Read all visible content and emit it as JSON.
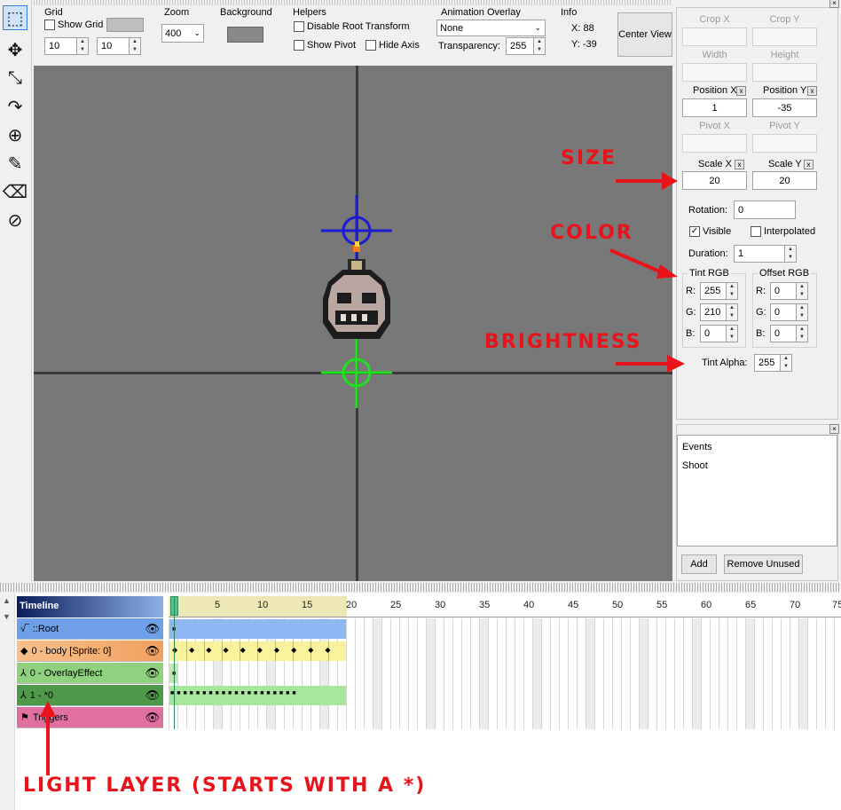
{
  "toolbar": {
    "grid": {
      "title": "Grid",
      "show_grid_label": "Show Grid",
      "show_grid_checked": false,
      "size_x": "10",
      "size_y": "10"
    },
    "zoom": {
      "title": "Zoom",
      "value": "400"
    },
    "background": {
      "title": "Background"
    },
    "helpers": {
      "title": "Helpers",
      "disable_root_label": "Disable Root Transform",
      "show_pivot_label": "Show Pivot",
      "hide_axis_label": "Hide Axis"
    },
    "overlay": {
      "title": "Animation Overlay",
      "value": "None",
      "transparency_label": "Transparency:",
      "transparency_value": "255"
    },
    "info": {
      "title": "Info",
      "x": "X: 88",
      "y": "Y: -39"
    },
    "center_view_label": "Center View"
  },
  "tools": [
    {
      "name": "select-tool",
      "glyph": "⬚"
    },
    {
      "name": "move-tool",
      "glyph": "✥"
    },
    {
      "name": "scale-tool",
      "glyph": "⤡"
    },
    {
      "name": "rotate-tool",
      "glyph": "↷"
    },
    {
      "name": "pivot-tool",
      "glyph": "⊕"
    },
    {
      "name": "pencil-tool",
      "glyph": "✎"
    },
    {
      "name": "eraser-tool",
      "glyph": "⌫"
    },
    {
      "name": "anchor-tool",
      "glyph": "⊘"
    }
  ],
  "properties": {
    "crop_x": "Crop X",
    "crop_y": "Crop Y",
    "width": "Width",
    "height": "Height",
    "position_x_label": "Position X",
    "position_y_label": "Position Y",
    "position_x": "1",
    "position_y": "-35",
    "pivot_x": "Pivot X",
    "pivot_y": "Pivot Y",
    "scale_x_label": "Scale X",
    "scale_y_label": "Scale Y",
    "scale_x": "20",
    "scale_y": "20",
    "rotation_label": "Rotation:",
    "rotation": "0",
    "visible_label": "Visible",
    "visible_checked": true,
    "interpolated_label": "Interpolated",
    "interpolated_checked": false,
    "duration_label": "Duration:",
    "duration": "1",
    "tint_title": "Tint RGB",
    "offset_title": "Offset RGB",
    "tint": {
      "r": "255",
      "g": "210",
      "b": "0"
    },
    "offset": {
      "r": "0",
      "g": "0",
      "b": "0"
    },
    "r": "R:",
    "g": "G:",
    "b": "B:",
    "tint_alpha_label": "Tint Alpha:",
    "tint_alpha": "255",
    "x_mark": "x"
  },
  "events": {
    "items": [
      "Events",
      "Shoot"
    ],
    "add_label": "Add",
    "remove_label": "Remove Unused"
  },
  "timeline": {
    "title": "Timeline",
    "ticks": [
      "5",
      "10",
      "15",
      "20",
      "25",
      "30",
      "35",
      "40",
      "45",
      "50",
      "55",
      "60",
      "65",
      "70",
      "75"
    ],
    "layers": [
      {
        "label": "::Root",
        "icon": "√‾",
        "color": "#6f9fe6"
      },
      {
        "label": "0 - body [Sprite: 0]",
        "icon": "◆",
        "color": "#f2a36c"
      },
      {
        "label": "0 - OverlayEffect",
        "icon": "⅄",
        "color": "#8fd17e"
      },
      {
        "label": "1 - *0",
        "icon": "⅄",
        "color": "#4f9a4a"
      },
      {
        "label": "Triggers",
        "icon": "⚑",
        "color": "#e0709f"
      }
    ]
  },
  "annotations": {
    "size": "SIZE",
    "color": "COLOR",
    "brightness": "BRIGHTNESS",
    "light_layer": "LIGHT LAYER (STARTS WITH A *)"
  },
  "colors": {
    "accent": "#e8131b",
    "canvas": "#787878",
    "root_frames": "#8fb8f2",
    "body_frames": "#f7f29b",
    "light_frames": "#a6e79b"
  }
}
